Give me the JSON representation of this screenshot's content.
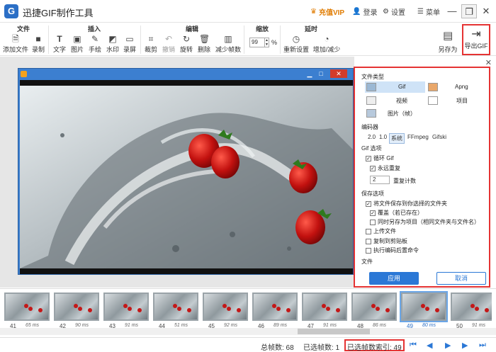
{
  "app": {
    "title": "迅捷GIF制作工具",
    "logo": "G"
  },
  "titlebar": {
    "vip": "充值VIP",
    "login": "登录",
    "settings": "设置",
    "menu": "菜单"
  },
  "ribbon": {
    "groups": {
      "file": "文件",
      "insert": "插入",
      "edit": "编辑",
      "zoom": "缩放",
      "delay": "延时"
    },
    "buttons": {
      "add_file": "添加文件",
      "record": "录制",
      "text": "文字",
      "image": "图片",
      "handwrite": "手绘",
      "watermark": "水印",
      "screen_record": "录屏",
      "crop": "裁剪",
      "undo": "撤销",
      "rotate": "旋转",
      "delete": "删除",
      "reduce_frames": "减少帧数",
      "reset": "重新设置",
      "inc_dec": "增加/减少",
      "save_as": "另存为",
      "export_gif": "导出GIF"
    },
    "zoom_value": "99",
    "zoom_unit": "%"
  },
  "panel": {
    "file_type_label": "文件类型",
    "file_types": [
      "Gif",
      "Apng",
      "视频",
      "项目",
      "图片（帧）"
    ],
    "encoder_label": "编码器",
    "encoders": [
      "2.0",
      "1.0",
      "系统",
      "FFmpeg",
      "Gifski"
    ],
    "gif_options_label": "Gif 选项",
    "loop": "循环 Gif",
    "forever": "永远重复",
    "repeat_count_value": "2",
    "repeat_count": "重复计数",
    "save_options_label": "保存选项",
    "save_to_folder": "将文件保存到你选择的文件夹",
    "overwrite": "覆盖（若已存在）",
    "save_as_project": "同时另存为项目（相同文件夹与文件名）",
    "upload": "上传文件",
    "copy_clipboard": "复制到剪贴板",
    "run_command": "执行编码后置命令",
    "file_label": "文件",
    "apply": "应用",
    "cancel": "取消"
  },
  "frames": [
    {
      "num": "41",
      "ms": "65 ms"
    },
    {
      "num": "42",
      "ms": "90 ms"
    },
    {
      "num": "43",
      "ms": "91 ms"
    },
    {
      "num": "44",
      "ms": "51 ms"
    },
    {
      "num": "45",
      "ms": "92 ms"
    },
    {
      "num": "46",
      "ms": "89 ms"
    },
    {
      "num": "47",
      "ms": "91 ms"
    },
    {
      "num": "48",
      "ms": "86 ms"
    },
    {
      "num": "49",
      "ms": "80 ms"
    },
    {
      "num": "50",
      "ms": "91 ms"
    }
  ],
  "status": {
    "total_frames": "总帧数: 68",
    "selected_frames": "已选帧数: 1",
    "selected_index": "已选帧数索引: 49"
  },
  "colors": {
    "accent": "#2b78d6",
    "highlight": "#e53333",
    "vip": "#e07b00"
  }
}
